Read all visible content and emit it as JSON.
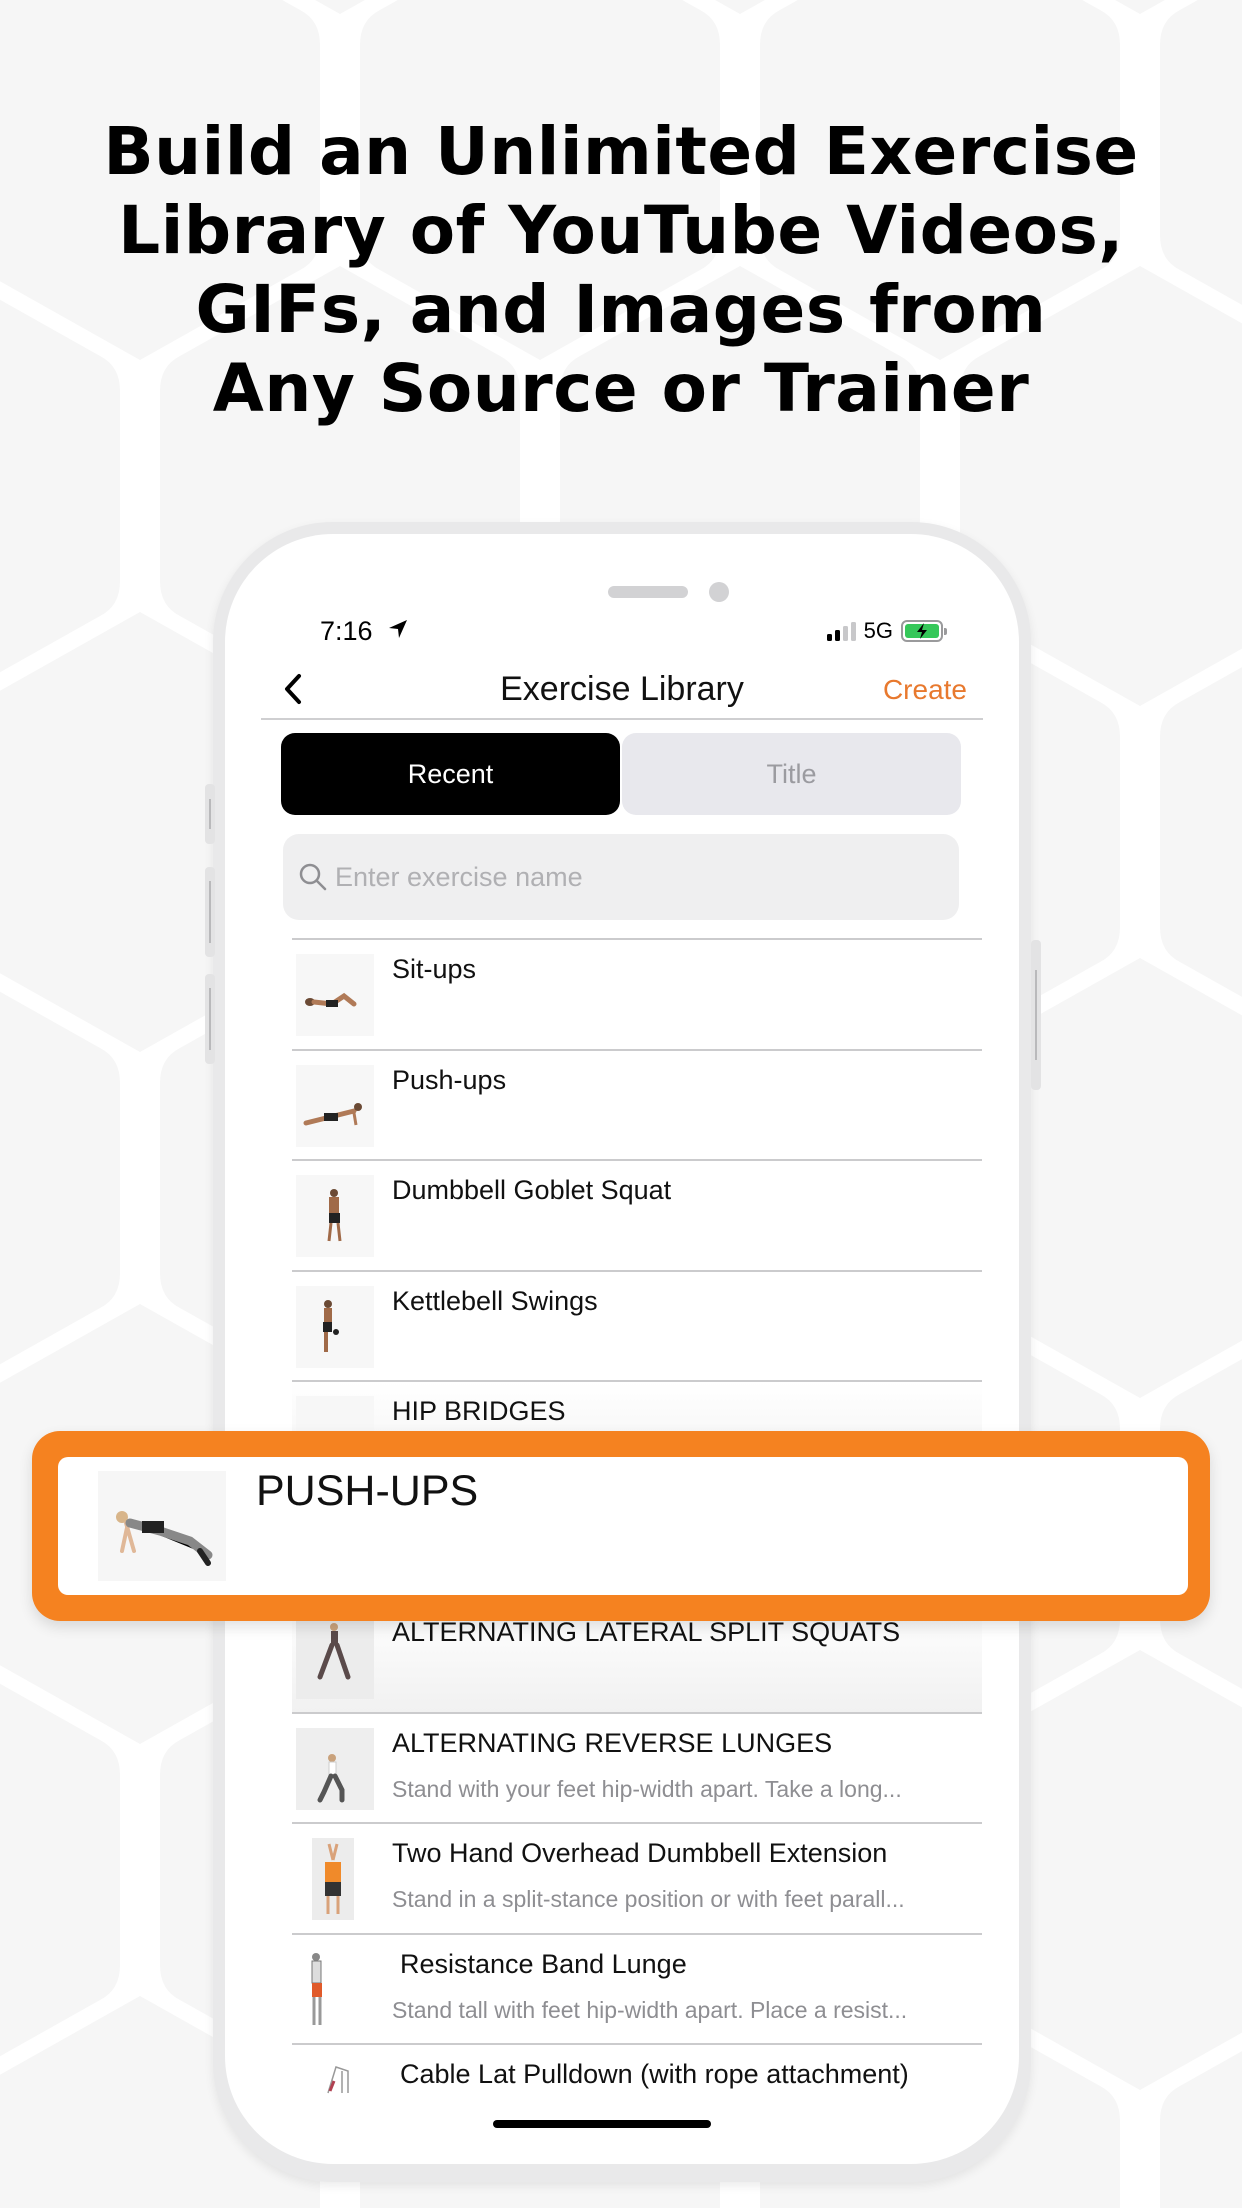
{
  "headline": {
    "lines": [
      "Build an Unlimited Exercise",
      "Library of YouTube Videos,",
      "GIFs, and Images from",
      "Any Source or Trainer"
    ]
  },
  "status_bar": {
    "time": "7:16",
    "network": "5G",
    "signal_bars_active": 2,
    "signal_bars_total": 4,
    "battery": "charging",
    "battery_color": "#35c759"
  },
  "nav": {
    "back_icon": "chevron-left-icon",
    "title": "Exercise Library",
    "create_label": "Create",
    "accent_color": "#e8792e"
  },
  "segmented": {
    "options": [
      "Recent",
      "Title"
    ],
    "selected": "Recent"
  },
  "search": {
    "placeholder": "Enter exercise name",
    "value": ""
  },
  "exercises": [
    {
      "name": "Sit-ups",
      "description": ""
    },
    {
      "name": "Push-ups",
      "description": ""
    },
    {
      "name": "Dumbbell Goblet Squat",
      "description": ""
    },
    {
      "name": "Kettlebell Swings",
      "description": ""
    },
    {
      "name": "HIP BRIDGES",
      "description": ""
    },
    {
      "name": "PUSH-UPS",
      "description": ""
    },
    {
      "name": "ALTERNATING LATERAL SPLIT SQUATS",
      "description": ""
    },
    {
      "name": "ALTERNATING REVERSE LUNGES",
      "description": "Stand with your feet hip-width apart. Take a long..."
    },
    {
      "name": "Two Hand Overhead Dumbbell Extension",
      "description": "Stand in a split-stance position or with feet parall..."
    },
    {
      "name": "Resistance Band Lunge",
      "description": "Stand tall with feet hip-width apart. Place a resist..."
    },
    {
      "name": "Cable Lat Pulldown (with rope attachment)",
      "description": ""
    }
  ],
  "highlight": {
    "name": "PUSH-UPS",
    "border_color": "#f58220"
  }
}
